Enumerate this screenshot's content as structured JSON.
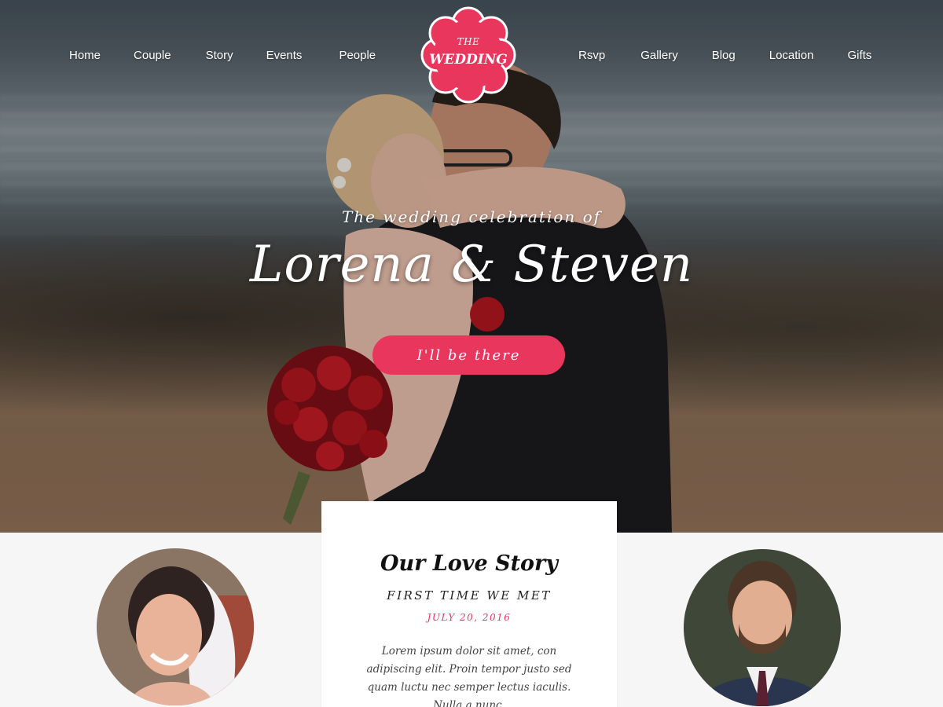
{
  "nav": {
    "left": [
      {
        "label": "Home"
      },
      {
        "label": "Couple"
      },
      {
        "label": "Story"
      },
      {
        "label": "Events"
      },
      {
        "label": "People"
      }
    ],
    "right": [
      {
        "label": "Rsvp"
      },
      {
        "label": "Gallery"
      },
      {
        "label": "Blog"
      },
      {
        "label": "Location"
      },
      {
        "label": "Gifts"
      }
    ]
  },
  "logo": {
    "line1": "THE",
    "line2": "WEDDING",
    "color": "#e8365d"
  },
  "hero": {
    "subtitle": "The wedding celebration of",
    "names": "Lorena & Steven",
    "cta_label": "I'll be there"
  },
  "story": {
    "title": "Our Love Story",
    "subtitle": "FIRST TIME WE MET",
    "date": "JULY 20, 2016",
    "text": "Lorem ipsum dolor sit amet, con adipiscing elit. Proin tempor justo sed quam luctu nec semper lectus iaculis. Nulla a nunc."
  },
  "colors": {
    "accent": "#e8365d",
    "background": "#f6f6f6"
  }
}
